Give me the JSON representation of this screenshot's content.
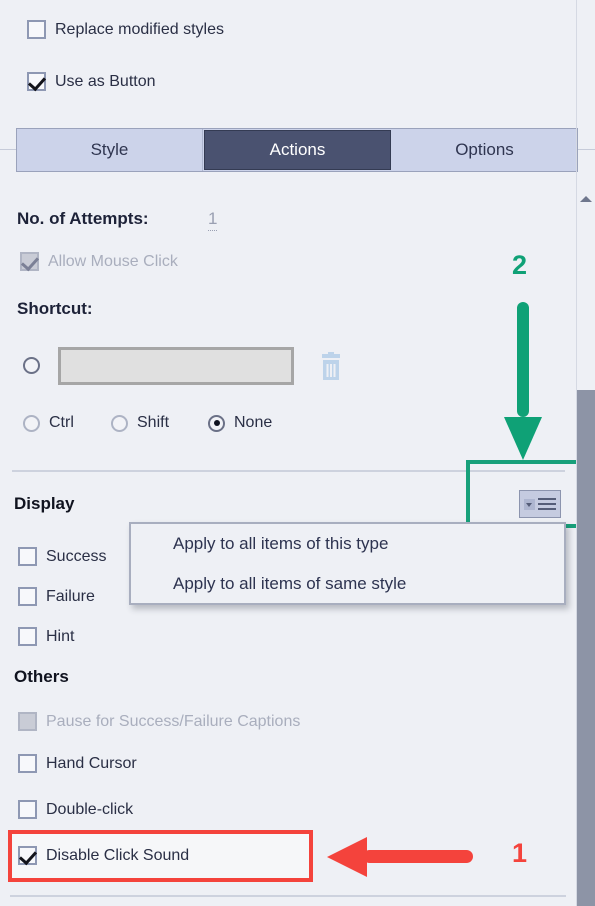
{
  "top_options": [
    {
      "label": "Replace modified styles",
      "checked": false,
      "disabled": false
    },
    {
      "label": "Use as Button",
      "checked": true,
      "disabled": false
    }
  ],
  "tabs": [
    {
      "label": "Style",
      "active": false
    },
    {
      "label": "Actions",
      "active": true
    },
    {
      "label": "Options",
      "active": false
    }
  ],
  "actions": {
    "attempts_label": "No. of Attempts:",
    "attempts_value": "1",
    "allow_mouse_click": {
      "label": "Allow Mouse Click",
      "checked": true,
      "disabled": true
    },
    "shortcut_label": "Shortcut:",
    "shortcut_value": "",
    "shortcut_placeholder": "",
    "delete_icon": "trash-icon",
    "modifiers": [
      {
        "label": "Ctrl",
        "selected": false
      },
      {
        "label": "Shift",
        "selected": false
      },
      {
        "label": "None",
        "selected": true
      }
    ]
  },
  "display": {
    "heading": "Display",
    "apply_button_icon": "apply-to-all-list-icon",
    "items": [
      {
        "label": "Success",
        "checked": false,
        "disabled": false
      },
      {
        "label": "Failure",
        "checked": false,
        "disabled": false
      },
      {
        "label": "Hint",
        "checked": false,
        "disabled": false
      }
    ]
  },
  "context_menu": {
    "items": [
      "Apply to all items of this type",
      "Apply to all items of same style"
    ]
  },
  "others": {
    "heading": "Others",
    "items": [
      {
        "label": "Pause for Success/Failure Captions",
        "checked": false,
        "disabled": true
      },
      {
        "label": "Hand Cursor",
        "checked": false,
        "disabled": false
      },
      {
        "label": "Double-click",
        "checked": false,
        "disabled": false
      },
      {
        "label": "Disable Click Sound",
        "checked": true,
        "disabled": false
      }
    ]
  },
  "annotations": [
    {
      "number": "2",
      "color": "#0fa176",
      "direction": "down",
      "target": "apply-to-all-button"
    },
    {
      "number": "1",
      "color": "#f4433c",
      "direction": "left",
      "target": "disable-click-sound-checkbox"
    }
  ],
  "colors": {
    "background": "#eef0f5",
    "tab_active_bg": "#4a5270",
    "tab_inactive_bg": "#ccd3ea",
    "highlight_green": "#17a07a",
    "highlight_red": "#f4433c",
    "scrollbar_thumb": "#8d94a6"
  }
}
